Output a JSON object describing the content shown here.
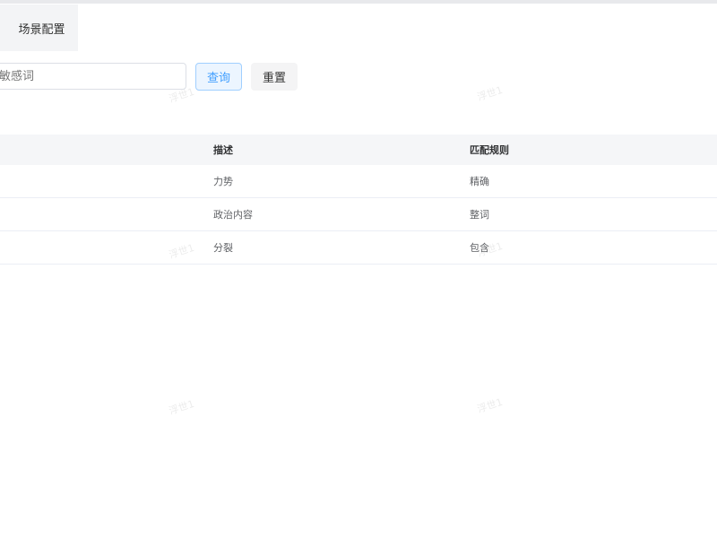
{
  "tabs": [
    {
      "label": "场景配置"
    }
  ],
  "search": {
    "placeholder": "敏感词",
    "value": "",
    "query_label": "查询",
    "reset_label": "重置"
  },
  "table": {
    "columns": [
      "描述",
      "匹配规则"
    ],
    "rows": [
      {
        "description": "力势",
        "rule": "精确"
      },
      {
        "description": "政治内容",
        "rule": "整词"
      },
      {
        "description": "分裂",
        "rule": "包含"
      }
    ]
  },
  "watermark": {
    "text": "浮世1"
  },
  "colors": {
    "accent": "#409eff",
    "header_bg": "#f5f6f8",
    "tab_bg": "#f3f4f6"
  }
}
